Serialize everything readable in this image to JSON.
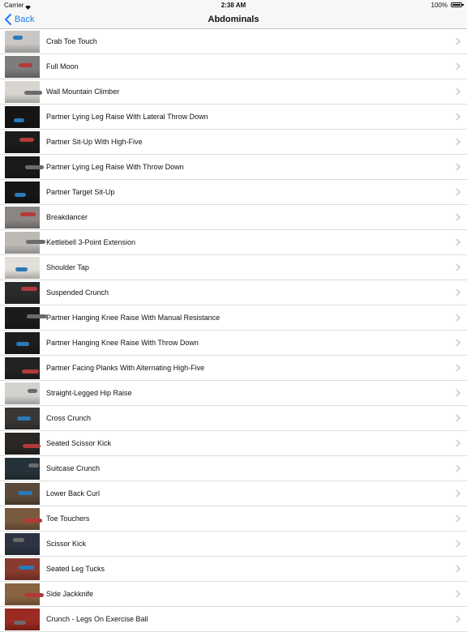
{
  "status_bar": {
    "carrier": "Carrier",
    "time": "2:38 AM",
    "battery": "100%"
  },
  "nav": {
    "back_label": "Back",
    "title": "Abdominals"
  },
  "colors": {
    "accent": "#1a7cf5",
    "chevron": "#c4c4c8"
  },
  "exercises": [
    {
      "label": "Crab Toe Touch",
      "thumb": "#c9c6c3"
    },
    {
      "label": "Full Moon",
      "thumb": "#7d7d7d"
    },
    {
      "label": "Wall Mountain Climber",
      "thumb": "#d8d5d0"
    },
    {
      "label": "Partner Lying Leg Raise With Lateral Throw Down",
      "thumb": "#151515"
    },
    {
      "label": "Partner Sit-Up With High-Five",
      "thumb": "#1c1c1c"
    },
    {
      "label": "Partner Lying Leg Raise With Throw Down",
      "thumb": "#1a1a1a"
    },
    {
      "label": "Partner Target Sit-Up",
      "thumb": "#161616"
    },
    {
      "label": "Breakdancer",
      "thumb": "#8a8683"
    },
    {
      "label": "Kettlebell 3-Point Extension",
      "thumb": "#bdbab6"
    },
    {
      "label": "Shoulder Tap",
      "thumb": "#e2ded9"
    },
    {
      "label": "Suspended Crunch",
      "thumb": "#2b2b2b"
    },
    {
      "label": "Partner Hanging Knee Raise With Manual Resistance",
      "thumb": "#1b1b1b"
    },
    {
      "label": "Partner Hanging Knee Raise With Throw Down",
      "thumb": "#1d1d1d"
    },
    {
      "label": "Partner Facing Planks With Alternating High-Five",
      "thumb": "#222222"
    },
    {
      "label": "Straight-Legged Hip Raise",
      "thumb": "#d4d2cf"
    },
    {
      "label": "Cross Crunch",
      "thumb": "#3a3633"
    },
    {
      "label": "Seated Scissor Kick",
      "thumb": "#2a2724"
    },
    {
      "label": "Suitcase Crunch",
      "thumb": "#26323a"
    },
    {
      "label": "Lower Back Curl",
      "thumb": "#5a4a3a"
    },
    {
      "label": "Toe Touchers",
      "thumb": "#7a5a3e"
    },
    {
      "label": "Scissor Kick",
      "thumb": "#2e3342"
    },
    {
      "label": "Seated Leg Tucks",
      "thumb": "#8a3a2e"
    },
    {
      "label": "Side Jackknife",
      "thumb": "#8a6440"
    },
    {
      "label": "Crunch - Legs On Exercise Ball",
      "thumb": "#9a2a22"
    }
  ]
}
